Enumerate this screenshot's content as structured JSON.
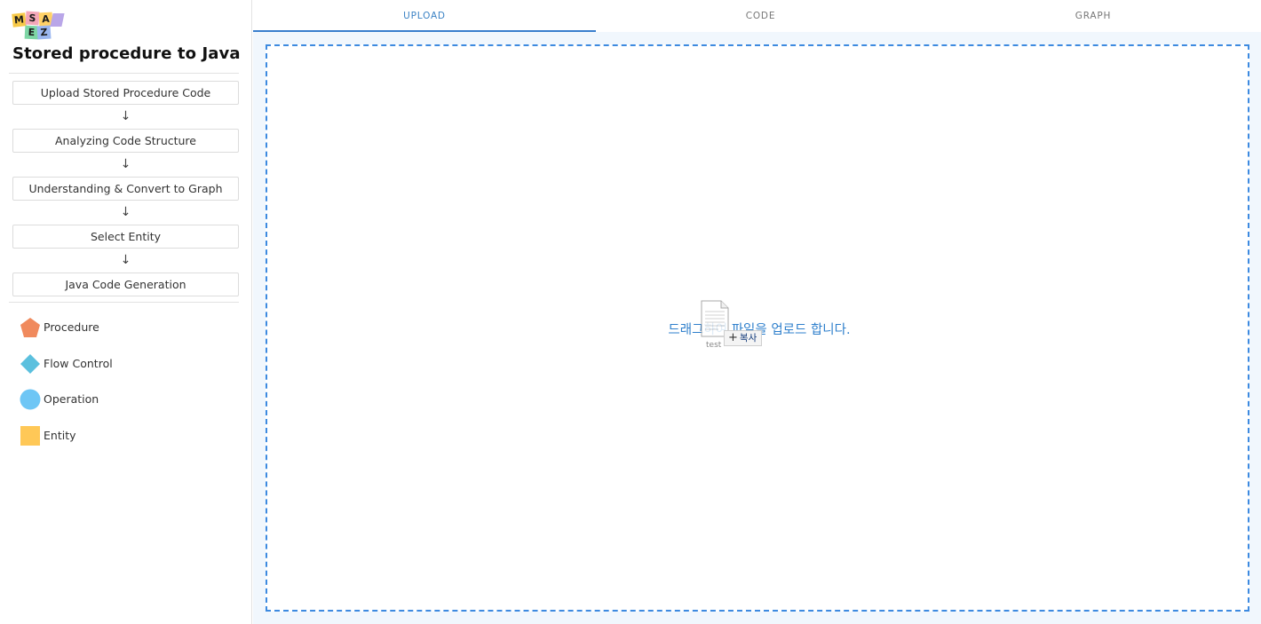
{
  "logo": {
    "letters": [
      "M",
      "S",
      "A",
      "E",
      "Z"
    ]
  },
  "app": {
    "title": "Stored procedure to Java"
  },
  "steps": [
    {
      "label": "Upload Stored Procedure Code"
    },
    {
      "label": "Analyzing Code Structure"
    },
    {
      "label": "Understanding & Convert to Graph"
    },
    {
      "label": "Select Entity"
    },
    {
      "label": "Java Code Generation"
    }
  ],
  "step_arrow": "↓",
  "legend": [
    {
      "label": "Procedure",
      "shape": "pentagon",
      "color": "#f08a5d"
    },
    {
      "label": "Flow Control",
      "shape": "diamond",
      "color": "#5bc0de"
    },
    {
      "label": "Operation",
      "shape": "circle",
      "color": "#6ec6f5"
    },
    {
      "label": "Entity",
      "shape": "square",
      "color": "#ffc857"
    }
  ],
  "tabs": [
    {
      "label": "UPLOAD",
      "active": true
    },
    {
      "label": "CODE",
      "active": false
    },
    {
      "label": "GRAPH",
      "active": false
    }
  ],
  "upload": {
    "prompt": "드래그하여 파일을 업로드 합니다.",
    "drag_file_name": "test",
    "drag_badge": "복사"
  },
  "colors": {
    "accent": "#3a7fcd",
    "dropzone_border": "#3d8ae0",
    "main_background": "#f1f7fd"
  }
}
